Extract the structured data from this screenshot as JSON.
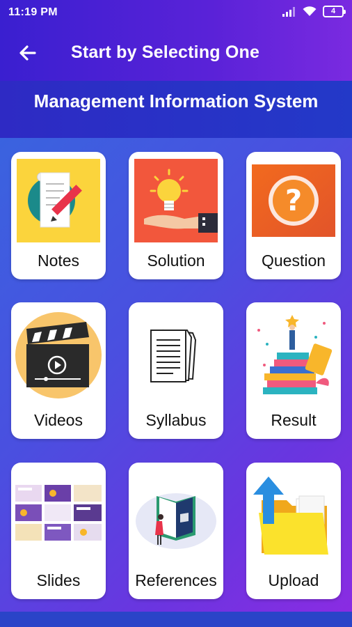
{
  "status_bar": {
    "time": "11:19 PM",
    "battery": "4"
  },
  "app_bar": {
    "title": "Start by Selecting One",
    "back_icon": "arrow-left-icon"
  },
  "subheader": {
    "title": "Management Information System"
  },
  "colors": {
    "app_bar": "#4a20d4",
    "grid_gradient_start": "#3a63df",
    "grid_gradient_end": "#8a2ce2",
    "card": "#ffffff"
  },
  "menu": [
    {
      "label": "Notes",
      "icon": "notes-icon"
    },
    {
      "label": "Solution",
      "icon": "lightbulb-hand-icon"
    },
    {
      "label": "Question",
      "icon": "question-icon"
    },
    {
      "label": "Videos",
      "icon": "clapperboard-icon"
    },
    {
      "label": "Syllabus",
      "icon": "documents-icon"
    },
    {
      "label": "Result",
      "icon": "trophy-books-icon"
    },
    {
      "label": "Slides",
      "icon": "slides-icon"
    },
    {
      "label": "References",
      "icon": "book-reader-icon"
    },
    {
      "label": "Upload",
      "icon": "folder-upload-icon"
    }
  ]
}
